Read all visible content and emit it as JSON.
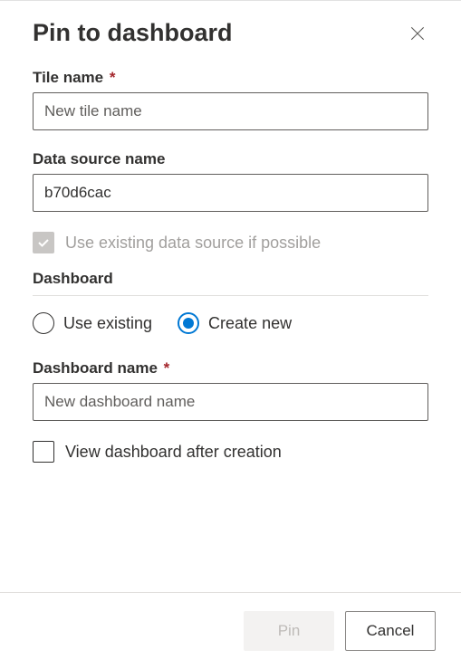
{
  "dialog": {
    "title": "Pin to dashboard",
    "tileName": {
      "label": "Tile name",
      "required": "*",
      "placeholder": "New tile name",
      "value": ""
    },
    "dataSource": {
      "label": "Data source name",
      "value": "b70d6cac"
    },
    "useExisting": {
      "label": "Use existing data source if possible"
    },
    "dashboardSection": {
      "label": "Dashboard"
    },
    "radioOptions": {
      "useExisting": "Use existing",
      "createNew": "Create new"
    },
    "dashboardName": {
      "label": "Dashboard name",
      "required": "*",
      "placeholder": "New dashboard name",
      "value": ""
    },
    "viewAfter": {
      "label": "View dashboard after creation"
    },
    "buttons": {
      "pin": "Pin",
      "cancel": "Cancel"
    }
  }
}
